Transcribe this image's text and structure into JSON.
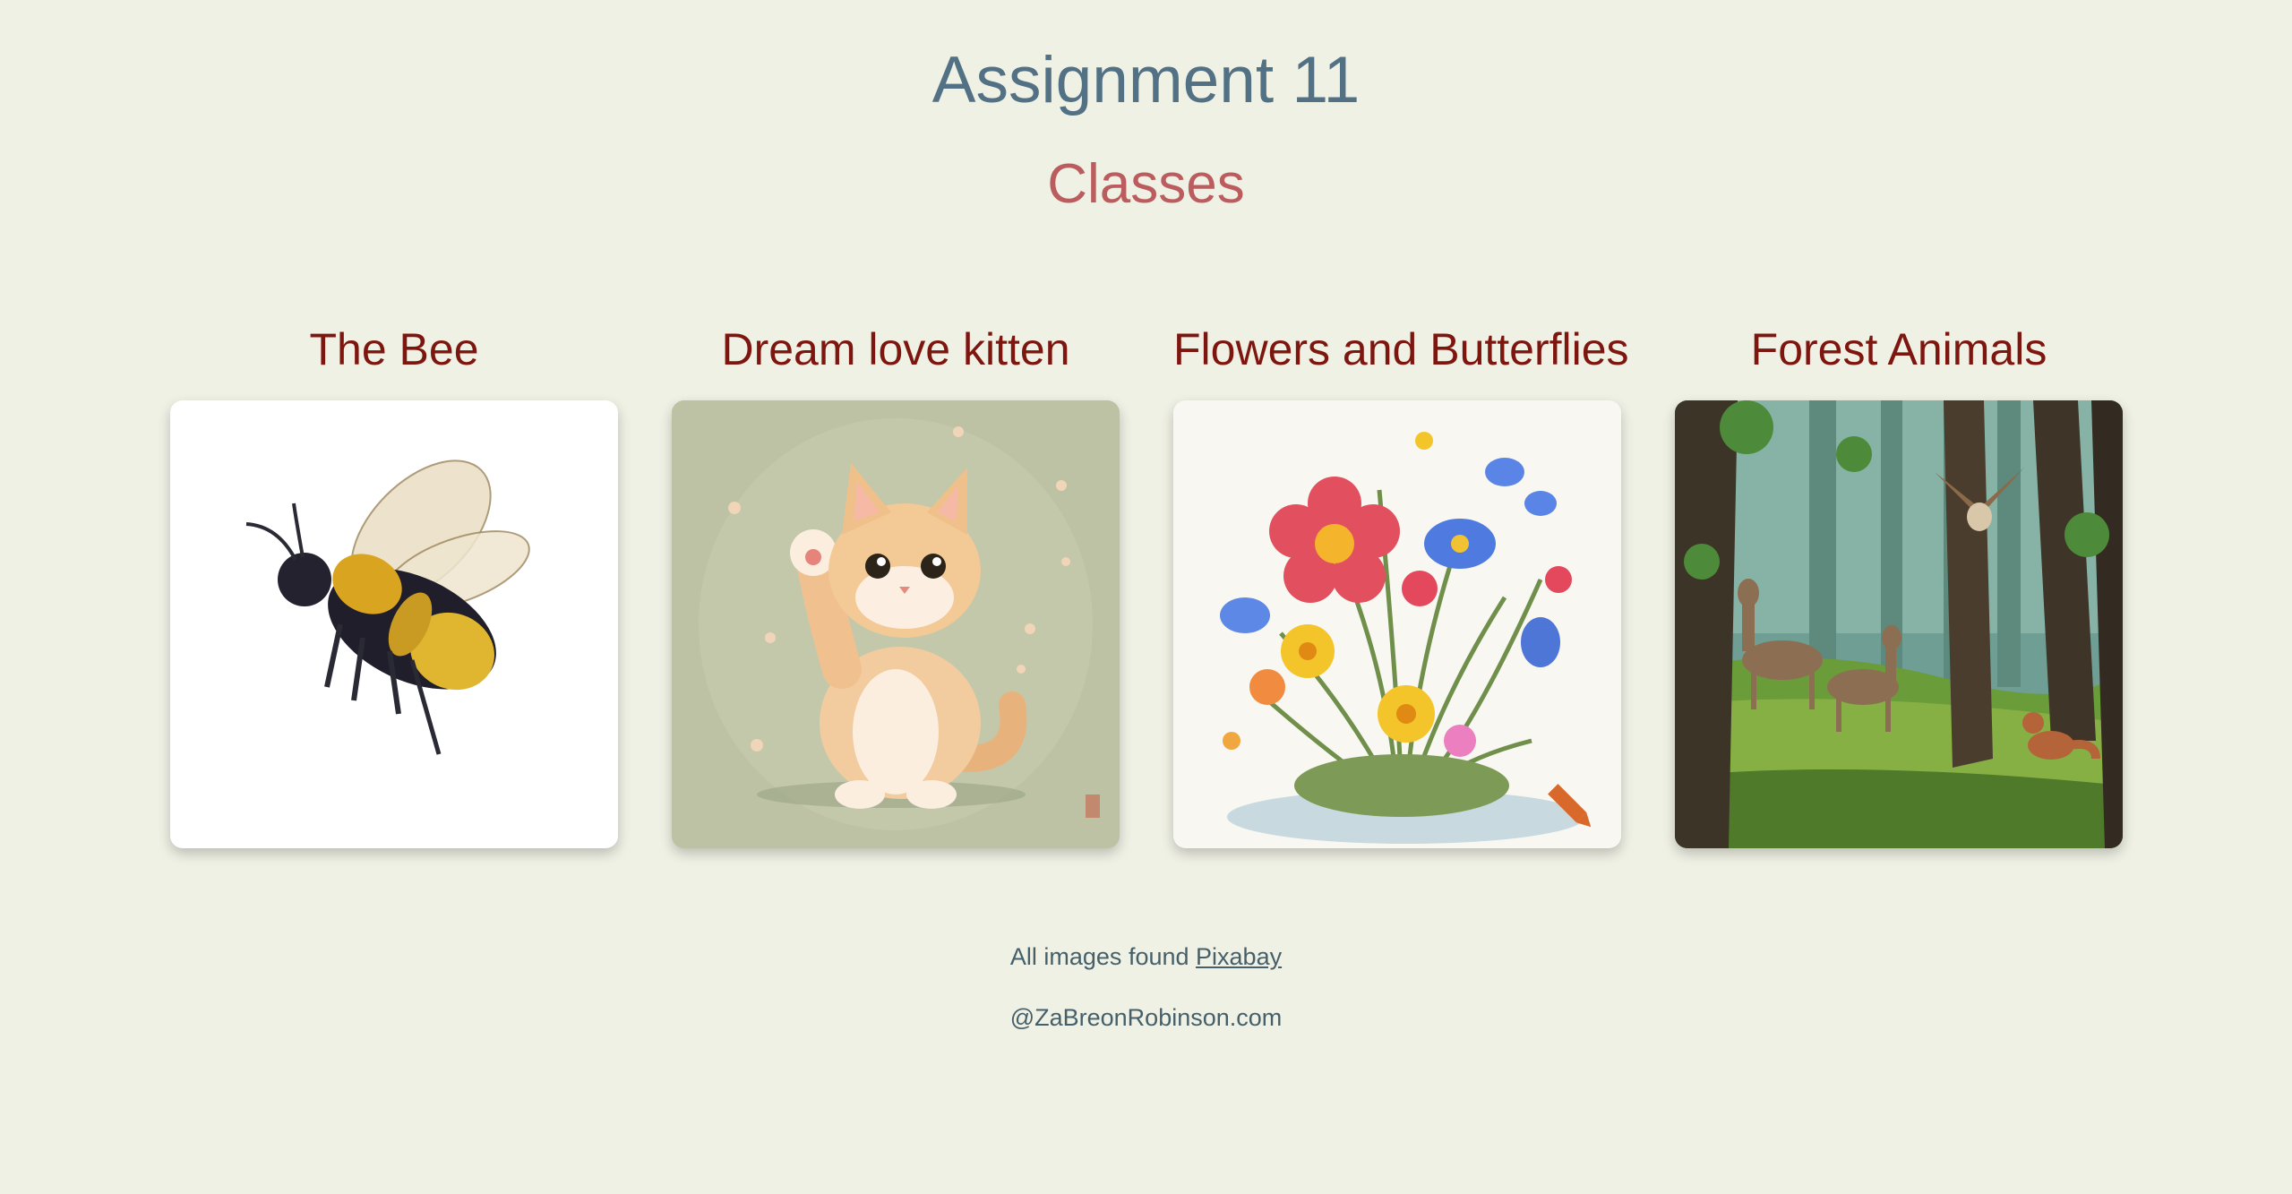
{
  "header": {
    "title": "Assignment 11",
    "subtitle": "Classes"
  },
  "cards": [
    {
      "title": "The Bee",
      "image": "bee-illustration"
    },
    {
      "title": "Dream love kitten",
      "image": "kitten-illustration"
    },
    {
      "title": "Flowers and Butterflies",
      "image": "flowers-illustration"
    },
    {
      "title": "Forest Animals",
      "image": "forest-illustration"
    }
  ],
  "footer": {
    "source_text": "All images found",
    "source_link": "Pixabay",
    "credit": "@ZaBreonRobinson.com"
  }
}
